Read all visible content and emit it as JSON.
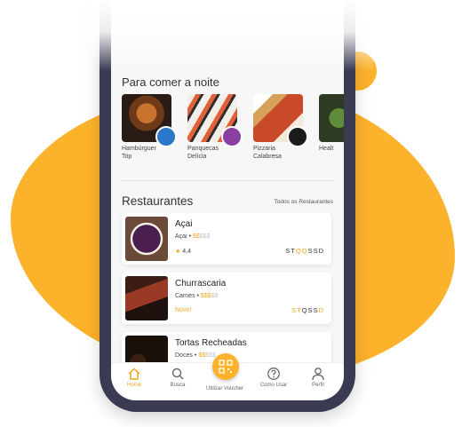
{
  "colors": {
    "accent": "#fdb22b",
    "frame": "#3a3b52"
  },
  "sections": {
    "night_title": "Para comer a noite",
    "restaurants_title": "Restaurantes",
    "see_all": "Todos os Restaurantes"
  },
  "categories": [
    {
      "line1": "Hambúrguer",
      "line2": "Top",
      "badge_icon": "burger-badge-icon"
    },
    {
      "line1": "Panquecas",
      "line2": "Delícia",
      "badge_icon": "pancake-badge-icon"
    },
    {
      "line1": "Pizzaria",
      "line2": "Calabresa",
      "badge_icon": "pizza-badge-icon"
    },
    {
      "line1": "Healt",
      "line2": ""
    }
  ],
  "restaurants": [
    {
      "name": "Açai",
      "type": "Açai",
      "price_on": "$$",
      "price_off": "$$$",
      "rating": "4,4",
      "days": [
        "S",
        "T",
        "Q",
        "Q",
        "S",
        "S",
        "D"
      ],
      "days_off": [
        false,
        false,
        true,
        true,
        false,
        false,
        false
      ]
    },
    {
      "name": "Churrascaria",
      "type": "Carnes",
      "price_on": "$$$",
      "price_off": "$$",
      "tag": "Novo!",
      "days": [
        "S",
        "T",
        "Q",
        "S",
        "S",
        "D"
      ],
      "days_off": [
        true,
        true,
        false,
        false,
        false,
        true
      ]
    },
    {
      "name": "Tortas Recheadas",
      "type": "Doces",
      "price_on": "$$",
      "price_off": "$$$"
    }
  ],
  "nav": [
    {
      "label": "Home",
      "icon": "home-icon",
      "active": true
    },
    {
      "label": "Busca",
      "icon": "search-icon"
    },
    {
      "label": "Utilizar Voucher",
      "icon": "qr-code-icon"
    },
    {
      "label": "Como Usar",
      "icon": "question-icon"
    },
    {
      "label": "Perfil",
      "icon": "user-icon"
    }
  ]
}
